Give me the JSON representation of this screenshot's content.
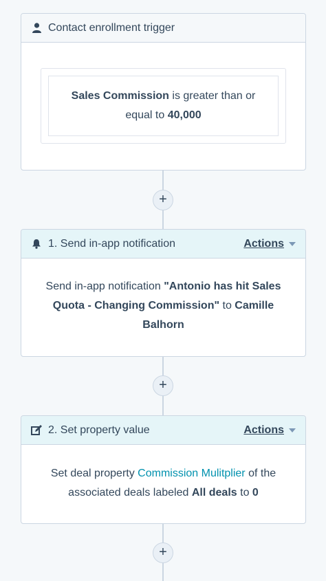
{
  "connectors": [
    {
      "add_label": "+"
    },
    {
      "add_label": "+"
    },
    {
      "add_label": "+"
    }
  ],
  "trigger": {
    "title": "Contact enrollment trigger",
    "icon": "person-icon",
    "filter": {
      "property": "Sales Commission",
      "operator_text": " is greater than or equal to ",
      "value": "40,000"
    }
  },
  "step1": {
    "title": "1. Send in-app notification",
    "icon": "bell-icon",
    "actions_label": "Actions",
    "body": {
      "prefix": "Send in-app notification ",
      "message": "\"Antonio has hit Sales Quota - Changing Commission\"",
      "middle": " to ",
      "recipient": "Camille Balhorn"
    }
  },
  "step2": {
    "title": "2. Set property value",
    "icon": "edit-icon",
    "actions_label": "Actions",
    "body": {
      "prefix": "Set deal property ",
      "property": "Commission Mulitplier",
      "middle": " of the associated deals labeled ",
      "label": "All deals",
      "to_text": " to ",
      "value": "0"
    }
  },
  "colors": {
    "accent_link": "#0091ae",
    "action_header_bg": "#e5f5f8",
    "trigger_header_bg": "#f5f8fa",
    "text": "#33475b"
  }
}
